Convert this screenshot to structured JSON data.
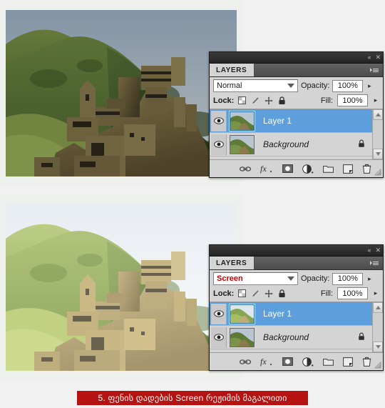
{
  "document": {
    "title": "Photoshop Screen blend mode example"
  },
  "panels": [
    {
      "id": "layers-panel-top",
      "tab_label": "LAYERS",
      "collapse_icon": "«",
      "close_icon": "✕",
      "blend_mode": "Normal",
      "blend_mode_is_highlighted": false,
      "opacity_label": "Opacity:",
      "opacity_value": "100%",
      "fill_label": "Fill:",
      "fill_value": "100%",
      "lock_label": "Lock:",
      "lock_icons": [
        "lock-transparent-pixels-icon",
        "lock-image-pixels-icon",
        "lock-position-icon",
        "lock-all-icon"
      ],
      "layers": [
        {
          "name": "Layer 1",
          "selected": true,
          "visible": true,
          "locked": false,
          "italic": false
        },
        {
          "name": "Background",
          "selected": false,
          "visible": true,
          "locked": true,
          "italic": true
        }
      ],
      "footer_icons": [
        "link-layers-icon",
        "layer-style-fx-icon",
        "add-layer-mask-icon",
        "new-adjustment-layer-icon",
        "new-group-icon",
        "new-layer-icon",
        "delete-layer-icon"
      ]
    },
    {
      "id": "layers-panel-bottom",
      "tab_label": "LAYERS",
      "collapse_icon": "«",
      "close_icon": "✕",
      "blend_mode": "Screen",
      "blend_mode_is_highlighted": true,
      "opacity_label": "Opacity:",
      "opacity_value": "100%",
      "fill_label": "Fill:",
      "fill_value": "100%",
      "lock_label": "Lock:",
      "lock_icons": [
        "lock-transparent-pixels-icon",
        "lock-image-pixels-icon",
        "lock-position-icon",
        "lock-all-icon"
      ],
      "layers": [
        {
          "name": "Layer 1",
          "selected": true,
          "visible": true,
          "locked": false,
          "italic": false
        },
        {
          "name": "Background",
          "selected": false,
          "visible": true,
          "locked": true,
          "italic": true
        }
      ],
      "footer_icons": [
        "link-layers-icon",
        "layer-style-fx-icon",
        "add-layer-mask-icon",
        "new-adjustment-layer-icon",
        "new-group-icon",
        "new-layer-icon",
        "delete-layer-icon"
      ]
    }
  ],
  "photos": [
    {
      "id": "photo-before",
      "description": "Shatili fortress ruins on a green mountain ridge, original exposure"
    },
    {
      "id": "photo-after",
      "description": "Same fortress ruins brightened by duplicating the layer in Screen blend mode"
    }
  ],
  "caption": {
    "full_text": "5. ფენის  დადების Screen რეჟიმის  მაგალითი",
    "number": "5.",
    "text_before": "ფენის  დადების",
    "mode_word": "Screen",
    "text_after": "რეჟიმის  მაგალითი",
    "background_color": "#b51212",
    "text_color": "#ffffff"
  },
  "colors": {
    "panel_background": "#d4d4d4",
    "panel_titlebar": "#2b2b2b",
    "selected_layer": "#5d9fdc",
    "screen_mode_text": "#cc0000",
    "page_background": "#f1f1f1"
  }
}
